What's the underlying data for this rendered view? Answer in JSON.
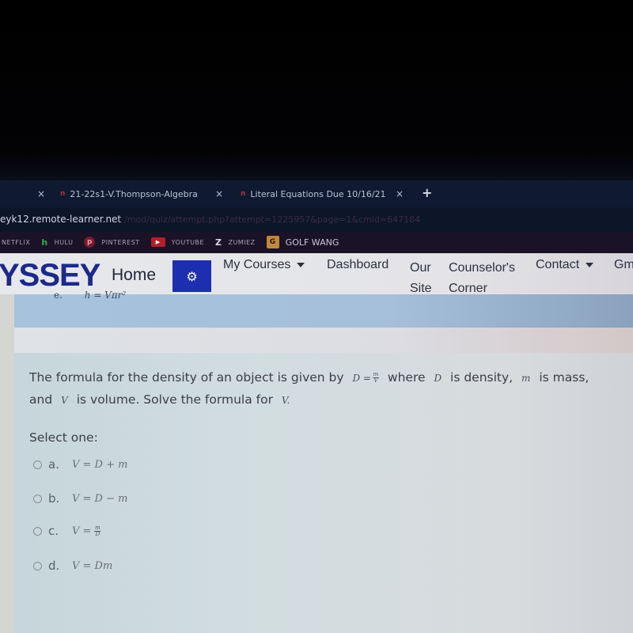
{
  "browser": {
    "tabs": [
      {
        "label": "",
        "close": "×"
      },
      {
        "label": "21-22s1-V.Thompson-Algebra",
        "favicon": "n",
        "close": "×"
      },
      {
        "label": "Literal Equations Due 10/16/21",
        "favicon": "n",
        "close": "×"
      }
    ],
    "new_tab": "+",
    "address": {
      "host": "eyk12.remote-learner.net",
      "path": "/mod/quiz/attempt.php?attempt=1225957&page=1&cmid=647184"
    },
    "bookmarks": [
      {
        "label": "NETFLIX",
        "icon": ""
      },
      {
        "label": "HULU",
        "icon": "h"
      },
      {
        "label": "PINTEREST",
        "icon": "p"
      },
      {
        "label": "YOUTUBE",
        "icon": "▶"
      },
      {
        "label": "ZUMIEZ",
        "icon": "Z"
      },
      {
        "label": "GOLF WANG",
        "icon": "G"
      }
    ]
  },
  "navbar": {
    "logo": "YSSEY",
    "home": "Home",
    "gear_icon": "⚙",
    "items": [
      {
        "label": "My Courses",
        "dropdown": true
      },
      {
        "label": "Dashboard"
      },
      {
        "label_line1": "Our",
        "label_line2": "Site"
      },
      {
        "label_line1": "Counselor's",
        "label_line2": "Corner"
      },
      {
        "label": "Contact",
        "dropdown": true
      },
      {
        "label": "Gm"
      }
    ]
  },
  "previous_question": {
    "option_letter": "e.",
    "equation": "h = Vπr²"
  },
  "question": {
    "text_part1": "The formula for the density of an object is given by",
    "formula_lhs": "D =",
    "formula_num": "m",
    "formula_den": "V",
    "text_part2": "where",
    "var_d": "D",
    "text_part3": "is density,",
    "var_m": "m",
    "text_part4": "is mass,",
    "text_part5": "and",
    "var_v": "V",
    "text_part6": "is volume.  Solve the formula for",
    "var_v2": "V.",
    "select_label": "Select one:",
    "options": [
      {
        "letter": "a.",
        "equation": "V = D + m"
      },
      {
        "letter": "b.",
        "equation": "V = D − m"
      },
      {
        "letter": "c.",
        "equation_lhs": "V =",
        "num": "m",
        "den": "D"
      },
      {
        "letter": "d.",
        "equation": "V = Dm"
      }
    ]
  }
}
